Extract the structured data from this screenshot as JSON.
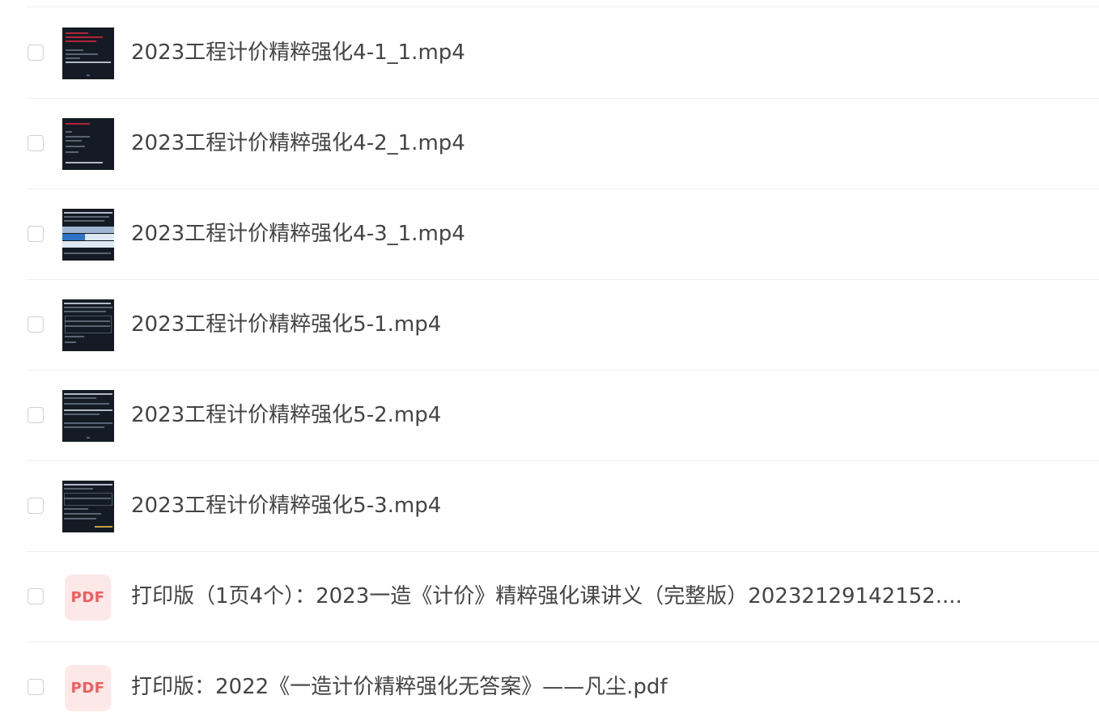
{
  "files": [
    {
      "name": "2023工程计价精粹强化4-1_1.mp4",
      "type": "video",
      "thumb_icon": "video-thumbnail"
    },
    {
      "name": "2023工程计价精粹强化4-2_1.mp4",
      "type": "video",
      "thumb_icon": "video-thumbnail"
    },
    {
      "name": "2023工程计价精粹强化4-3_1.mp4",
      "type": "video",
      "thumb_icon": "video-thumbnail"
    },
    {
      "name": "2023工程计价精粹强化5-1.mp4",
      "type": "video",
      "thumb_icon": "video-thumbnail"
    },
    {
      "name": "2023工程计价精粹强化5-2.mp4",
      "type": "video",
      "thumb_icon": "video-thumbnail"
    },
    {
      "name": "2023工程计价精粹强化5-3.mp4",
      "type": "video",
      "thumb_icon": "video-thumbnail"
    },
    {
      "name": "打印版（1页4个）：2023一造《计价》精粹强化课讲义（完整版）20232129142152....",
      "type": "pdf",
      "badge": "PDF"
    },
    {
      "name": "打印版：2022《一造计价精粹强化无答案》——凡尘.pdf",
      "type": "pdf",
      "badge": "PDF"
    }
  ],
  "colors": {
    "text": "#444444",
    "divider": "#eeeeee",
    "pdf_badge_bg": "#fde8e8",
    "pdf_badge_text": "#f25c5c",
    "video_thumb_bg": "#141b24"
  }
}
